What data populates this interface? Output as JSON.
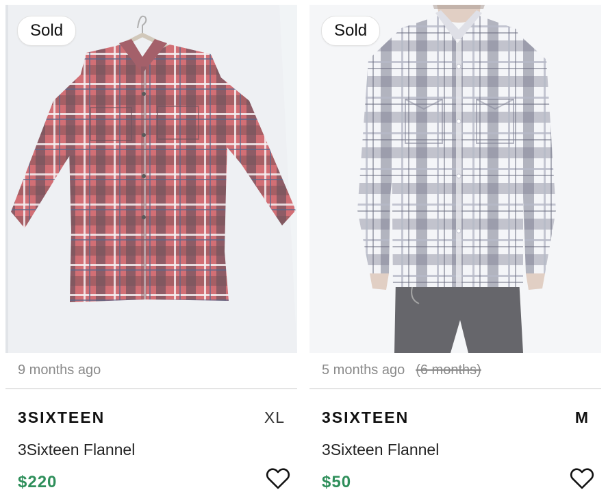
{
  "listings": [
    {
      "badge": "Sold",
      "time_ago": "9 months ago",
      "time_ago_old": "",
      "brand": "3SIXTEEN",
      "size": "XL",
      "title": "3Sixteen Flannel",
      "price": "$220",
      "image": "red plaid flannel shirt on hanger"
    },
    {
      "badge": "Sold",
      "time_ago": "5 months ago",
      "time_ago_old": "(6 months)",
      "brand": "3SIXTEEN",
      "size": "M",
      "title": "3Sixteen Flannel",
      "price": "$50",
      "image": "grey and white plaid flannel shirt worn by model"
    }
  ],
  "colors": {
    "price": "#2f8f5b",
    "muted_text": "#8a8a8a",
    "divider": "#e4e4e4"
  },
  "icons": {
    "favorite": "heart-outline-icon"
  }
}
